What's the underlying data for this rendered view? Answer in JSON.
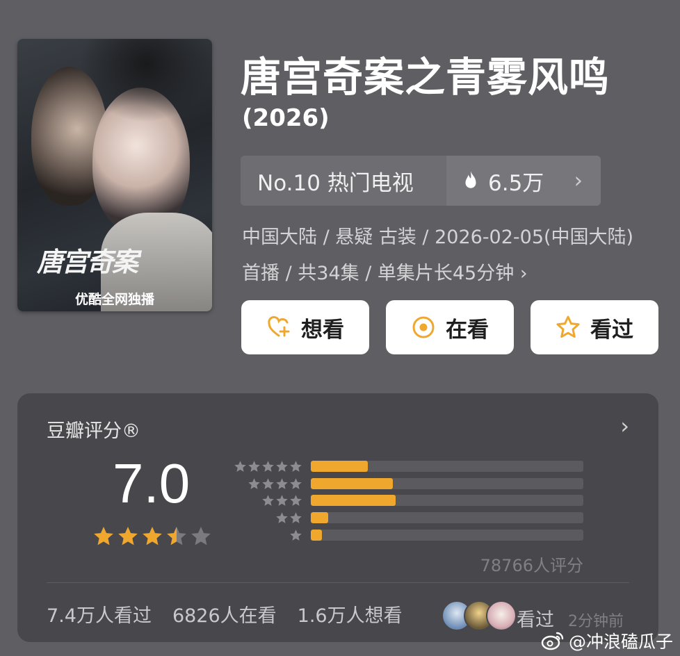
{
  "poster": {
    "title_art": "唐宫奇案",
    "platform": "优酷全网独播"
  },
  "title": "唐宫奇案之青雾风鸣",
  "year": "(2026)",
  "rank": {
    "label": "No.10 热门电视",
    "heat": "6.5万"
  },
  "meta": "中国大陆 / 悬疑 古装 / 2026-02-05(中国大陆)首播 / 共34集 / 单集片长45分钟 ›",
  "actions": {
    "want": "想看",
    "watching": "在看",
    "watched": "看过"
  },
  "rating": {
    "header": "豆瓣评分®",
    "score": "7.0",
    "stars_filled": 3.5,
    "distribution": [
      0.21,
      0.3,
      0.31,
      0.065,
      0.04
    ],
    "count": "78766人评分"
  },
  "stats": {
    "watched": "7.4万人看过",
    "watching": "6826人在看",
    "want": "1.6万人想看",
    "friends_label": "看过",
    "time_ago": "2分钟前"
  },
  "watermark": "@冲浪磕瓜子",
  "colors": {
    "accent": "#efa72e",
    "background": "#5f5e63",
    "card": "#48474c"
  }
}
